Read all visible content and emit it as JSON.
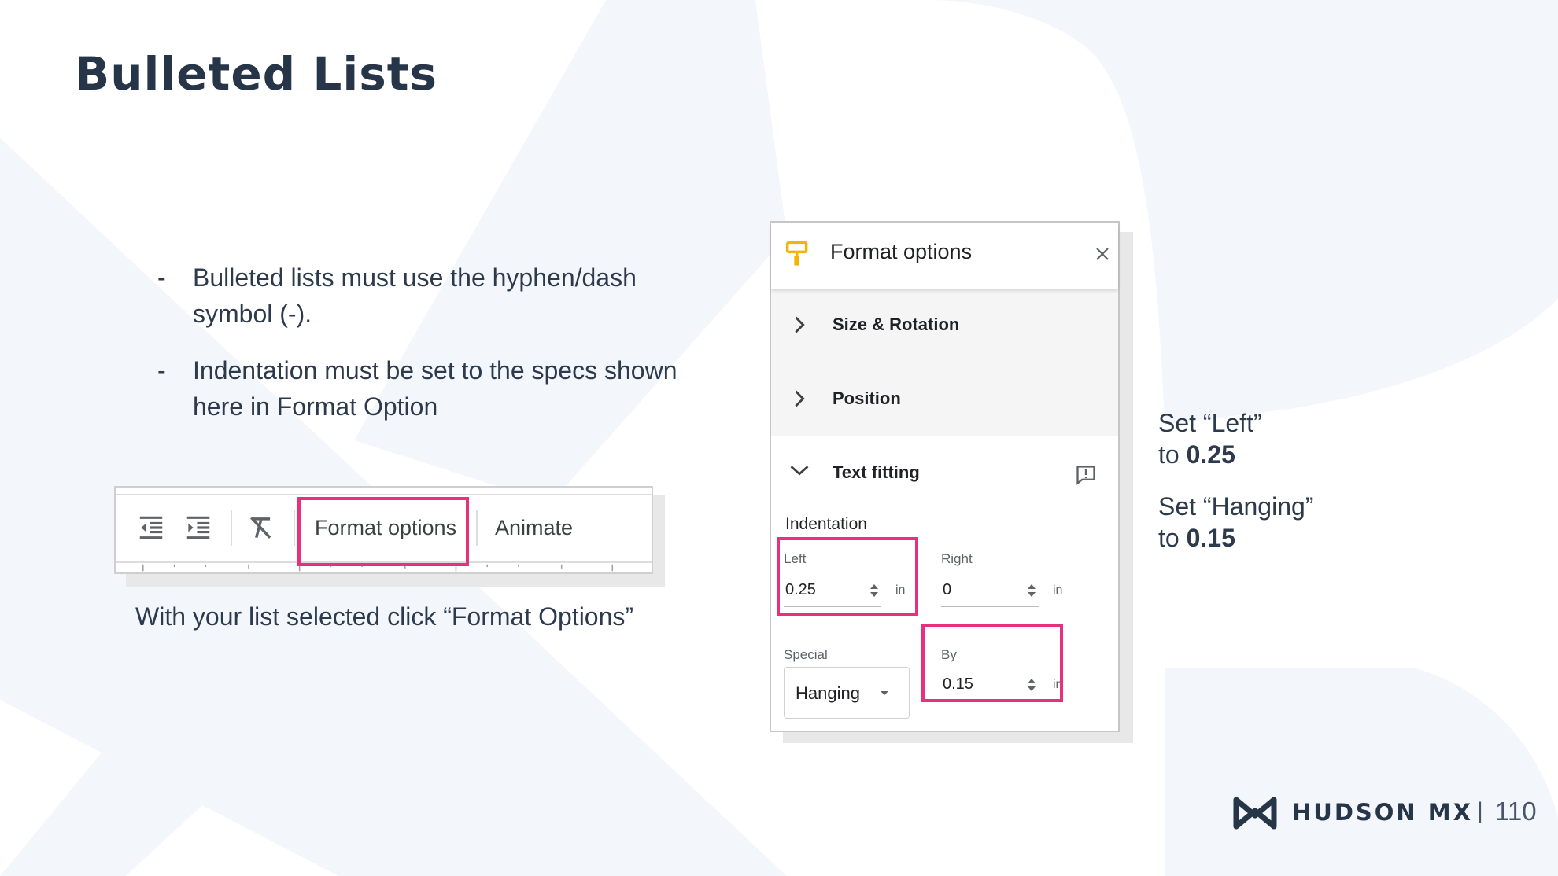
{
  "slide": {
    "title": "Bulleted Lists",
    "bullets": [
      {
        "dash": "-",
        "lines": [
          "Bulleted lists must use the hyphen/dash",
          "symbol (-)."
        ]
      },
      {
        "dash": "-",
        "lines": [
          "Indentation must be set to the specs shown",
          "here in Format Option"
        ]
      }
    ]
  },
  "toolbar": {
    "icons": [
      "decrease-indent-icon",
      "increase-indent-icon",
      "clear-formatting-icon"
    ],
    "format_options_label": "Format options",
    "animate_label": "Animate",
    "caption": "With your list selected click “Format Options”"
  },
  "panel": {
    "title": "Format options",
    "sections": {
      "size_rotation": "Size & Rotation",
      "position": "Position",
      "text_fitting": "Text fitting"
    },
    "indentation_label": "Indentation",
    "left": {
      "label": "Left",
      "value": "0.25",
      "unit": "in"
    },
    "right": {
      "label": "Right",
      "value": "0",
      "unit": "in"
    },
    "special": {
      "label": "Special",
      "value": "Hanging"
    },
    "by": {
      "label": "By",
      "value": "0.15",
      "unit": "in"
    }
  },
  "notes": {
    "left_line1": "Set “Left”",
    "left_prefix": "to ",
    "left_value": "0.25",
    "hanging_line1": "Set “Hanging”",
    "hanging_prefix": "to ",
    "hanging_value": "0.15"
  },
  "footer": {
    "brand": "HUDSON MX",
    "separator": "|",
    "page_number": "110"
  },
  "colors": {
    "highlight": "#e8307e",
    "title": "#263547",
    "icon_accent": "#f5b400",
    "background_shape": "#f3f7fc"
  }
}
